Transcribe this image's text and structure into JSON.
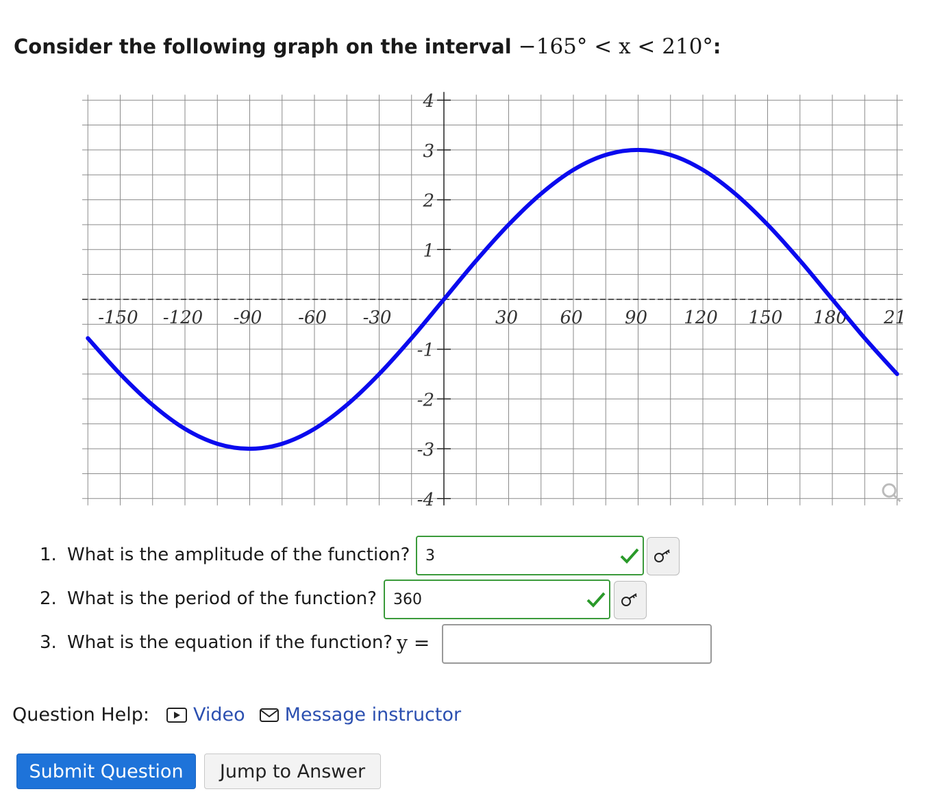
{
  "prompt": {
    "text": "Consider the following graph on the interval",
    "interval_math": "−165° < x < 210°",
    "suffix": ":"
  },
  "chart_data": {
    "type": "line",
    "x_ticks": [
      "-150",
      "-120",
      "-90",
      "-60",
      "-30",
      "30",
      "60",
      "90",
      "120",
      "150",
      "180",
      "21"
    ],
    "y_ticks": [
      "4",
      "3",
      "2",
      "1",
      "-1",
      "-2",
      "-3",
      "-4"
    ],
    "xlim": [
      -165,
      210
    ],
    "ylim": [
      -4,
      4
    ],
    "grid": true,
    "series": [
      {
        "color": "#0a0aee",
        "x": [
          -165,
          -150,
          -135,
          -120,
          -105,
          -90,
          -75,
          -60,
          -45,
          -30,
          -15,
          0,
          15,
          30,
          45,
          60,
          75,
          90,
          105,
          120,
          135,
          150,
          165,
          180,
          195,
          210
        ],
        "y": [
          -0.78,
          -1.5,
          -2.12,
          -2.6,
          -2.9,
          -3,
          -2.9,
          -2.6,
          -2.12,
          -1.5,
          -0.78,
          0,
          0.78,
          1.5,
          2.12,
          2.6,
          2.9,
          3,
          2.9,
          2.6,
          2.12,
          1.5,
          0.78,
          0,
          -0.78,
          -1.5
        ]
      }
    ],
    "icons": {
      "magnify": "magnify-icon"
    }
  },
  "questions": [
    {
      "num": "1.",
      "text": "What is the amplitude of the function?",
      "value": "3",
      "status": "correct"
    },
    {
      "num": "2.",
      "text": "What is the period of the function?",
      "value": "360",
      "status": "correct"
    },
    {
      "num": "3.",
      "text": "What is the equation if the function?",
      "math": "y =",
      "value": ""
    }
  ],
  "help": {
    "label": "Question Help:",
    "video": "Video",
    "message": "Message instructor"
  },
  "buttons": {
    "submit": "Submit Question",
    "jump": "Jump to Answer"
  },
  "colors": {
    "correct": "#2a9a2a",
    "curve": "#0a0aee",
    "link": "#2b4fb0",
    "primary": "#1e73d9"
  }
}
